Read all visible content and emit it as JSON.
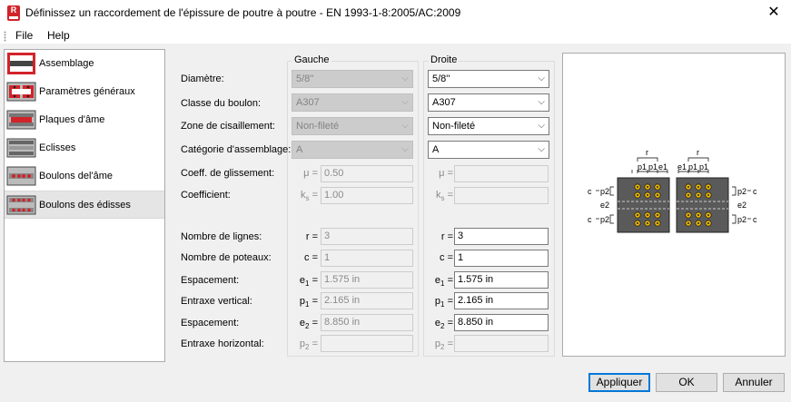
{
  "window": {
    "title": "Définissez un raccordement de l'épissure de poutre à poutre - EN 1993-1-8:2005/AC:2009",
    "app_icon_text": "R"
  },
  "menu": [
    "File",
    "Help"
  ],
  "sidebar": {
    "items": [
      {
        "label": "Assemblage",
        "selected": false
      },
      {
        "label": "Paramètres généraux",
        "selected": false
      },
      {
        "label": "Plaques d'âme",
        "selected": false
      },
      {
        "label": "Eclisses",
        "selected": false
      },
      {
        "label": "Boulons del'âme",
        "selected": false
      },
      {
        "label": "Boulons des édisses",
        "selected": true
      }
    ]
  },
  "groups": {
    "left_title": "Gauche",
    "right_title": "Droite"
  },
  "fields": {
    "diametre": {
      "label": "Diamètre:",
      "left": "5/8''",
      "right": "5/8''"
    },
    "classe": {
      "label": "Classe du boulon:",
      "left": "A307",
      "right": "A307"
    },
    "zone": {
      "label": "Zone de cisaillement:",
      "left": "Non-fileté",
      "right": "Non-fileté"
    },
    "categorie": {
      "label": "Catégorie d'assemblage:",
      "left": "A",
      "right": "A"
    },
    "glissement": {
      "label": "Coeff. de glissement:",
      "sym": "μ =",
      "left": "0.50",
      "right": ""
    },
    "coefficient": {
      "label": "Coefficient:",
      "sym": "k",
      "sym_sub": "s",
      "sym_eq": "=",
      "left": "1.00",
      "right": ""
    },
    "lignes": {
      "label": "Nombre de lignes:",
      "sym": "r =",
      "left": "3",
      "right": "3"
    },
    "poteaux": {
      "label": "Nombre de poteaux:",
      "sym": "c =",
      "left": "1",
      "right": "1"
    },
    "espacement1": {
      "label": "Espacement:",
      "sym": "e",
      "sym_sub": "1",
      "sym_eq": "=",
      "left": "1.575 in",
      "right": "1.575 in"
    },
    "entraxe_v": {
      "label": "Entraxe vertical:",
      "sym": "p",
      "sym_sub": "1",
      "sym_eq": "=",
      "left": "2.165 in",
      "right": "2.165 in"
    },
    "espacement2": {
      "label": "Espacement:",
      "sym": "e",
      "sym_sub": "2",
      "sym_eq": "=",
      "left": "8.850 in",
      "right": "8.850 in"
    },
    "entraxe_h": {
      "label": "Entraxe horizontal:",
      "sym": "p",
      "sym_sub": "2",
      "sym_eq": "=",
      "left": "",
      "right": ""
    }
  },
  "diagram": {
    "labels": {
      "r": "r",
      "p1": "p1",
      "e1": "e1",
      "c": "c",
      "p2": "p2",
      "e2": "e2"
    }
  },
  "buttons": {
    "apply": "Appliquer",
    "ok": "OK",
    "cancel": "Annuler"
  },
  "colors": {
    "accent": "#0078d7",
    "icon_red": "#d2232a",
    "bolt": "#e8b400",
    "plate": "#5a5a5a"
  }
}
